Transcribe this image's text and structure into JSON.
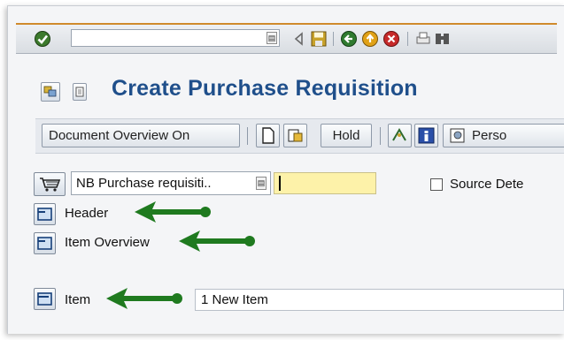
{
  "toolbar": {
    "command_field_value": "",
    "icons": [
      "enter-icon",
      "command-dropdown-icon",
      "back-arrow-icon",
      "save-icon",
      "green-back-icon",
      "exit-icon",
      "cancel-icon",
      "print-icon",
      "find-icon"
    ]
  },
  "title": "Create Purchase Requisition",
  "app_toolbar": {
    "document_overview_label": "Document Overview On",
    "hold_label": "Hold",
    "personal_label": "Perso"
  },
  "header_row": {
    "document_type": "NB Purchase requisiti..",
    "source_determination_label": "Source Dete"
  },
  "sections": {
    "header_label": "Header",
    "item_overview_label": "Item Overview",
    "item_label": "Item",
    "item_value": "1 New Item"
  },
  "colors": {
    "title": "#1f4f8b",
    "arrow": "#1f7a1f",
    "input_required": "#fdf2a9",
    "toolbar_accent": "#d08a2c"
  }
}
